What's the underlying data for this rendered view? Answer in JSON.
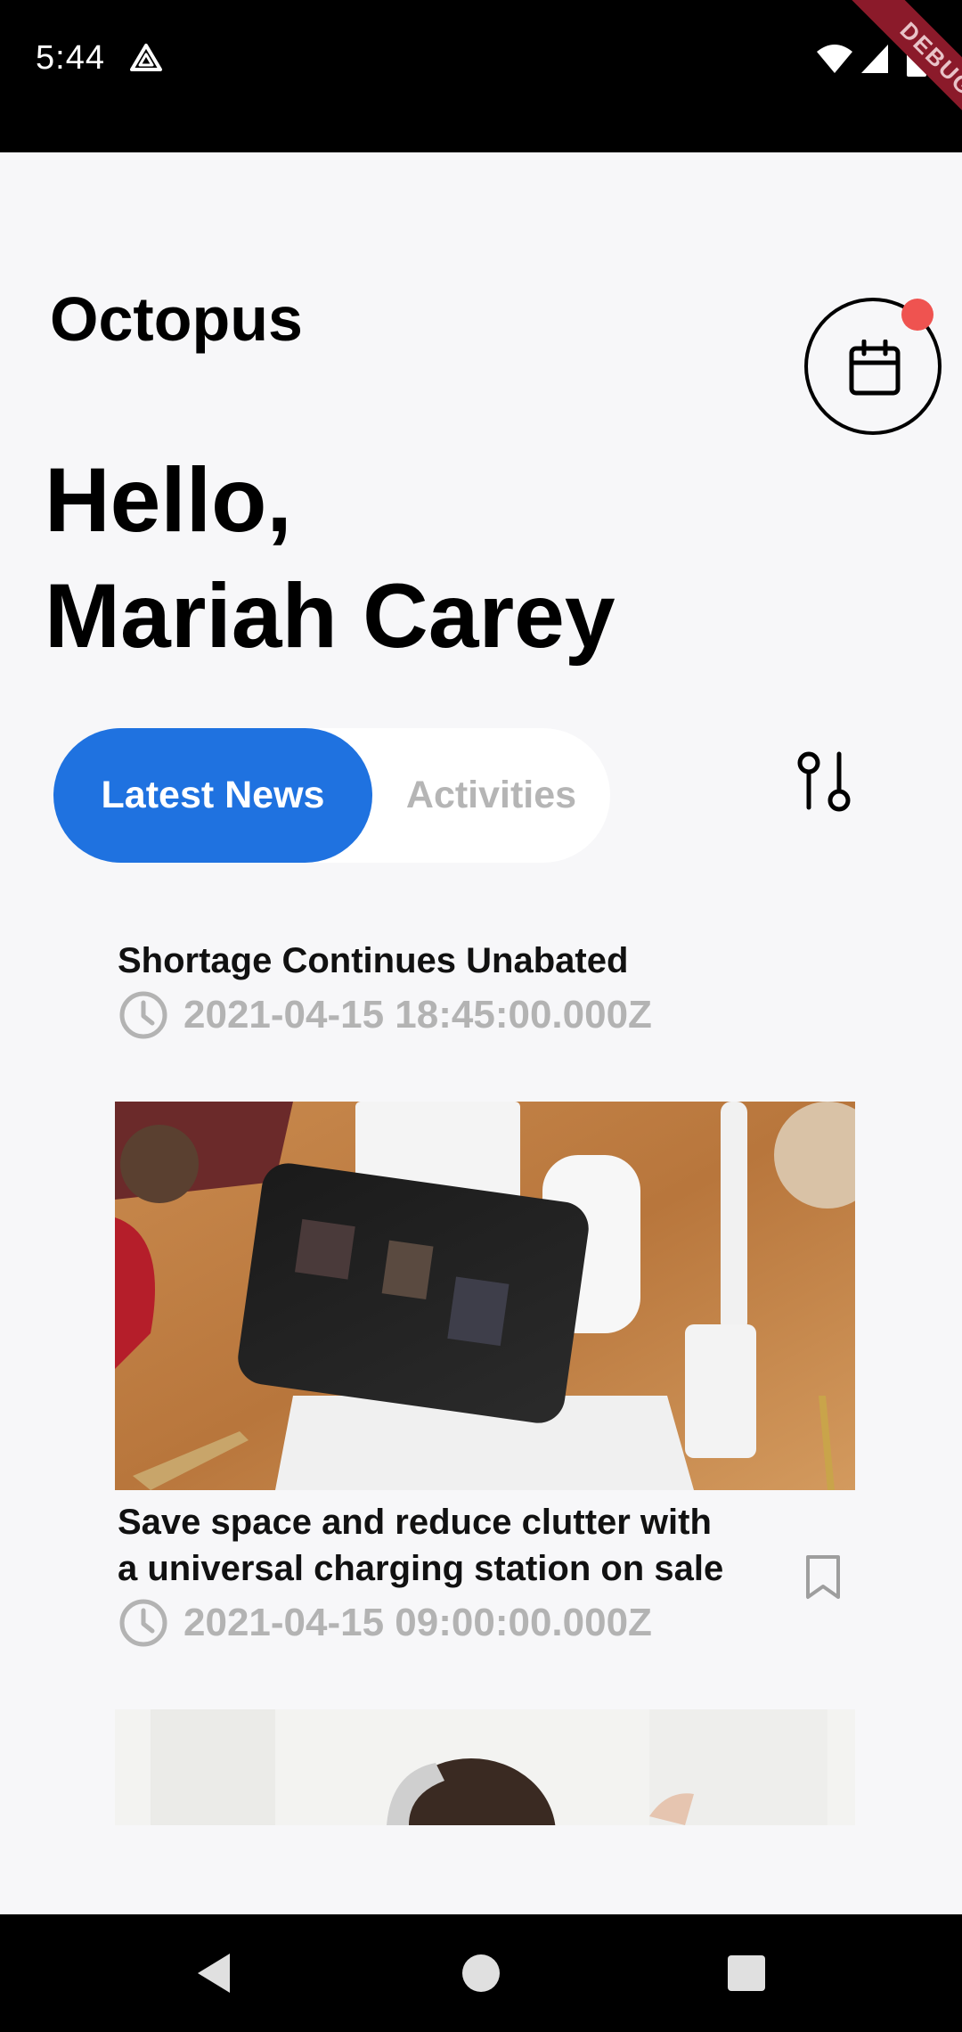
{
  "status_bar": {
    "time": "5:44",
    "debug_banner": "DEBUG"
  },
  "header": {
    "brand": "Octopus",
    "greeting_line1": "Hello,",
    "greeting_line2": "Mariah Carey"
  },
  "tabs": {
    "active": "Latest News",
    "inactive": "Activities"
  },
  "articles": [
    {
      "title_line1": "Shortage Continues Unabated",
      "time": "2021-04-15 18:45:00.000Z"
    },
    {
      "title_line1": "Save space and reduce clutter with",
      "title_line2": "a universal charging station on sale",
      "time": "2021-04-15 09:00:00.000Z"
    }
  ],
  "icons": {
    "calendar": "calendar-icon",
    "filter": "sliders-icon",
    "clock": "clock-icon",
    "bookmark": "bookmark-icon"
  },
  "colors": {
    "accent": "#1f72e0",
    "notification": "#ef5350",
    "muted": "#b3b3b3"
  }
}
